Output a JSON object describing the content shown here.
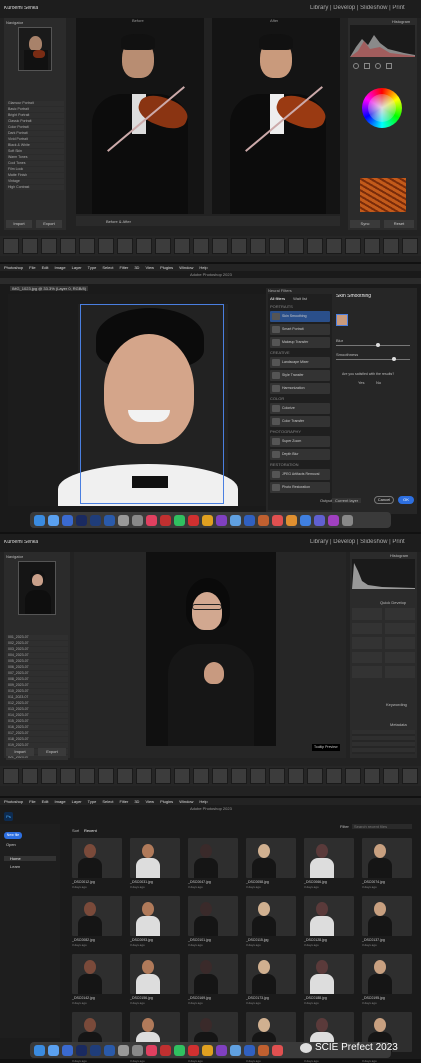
{
  "s1": {
    "app_title": "Kuroemi Senka",
    "modules": "Library | Develop | Slideshow | Print",
    "before_label": "Before",
    "after_label": "After",
    "navigator": "Navigator",
    "histogram": "Histogram",
    "import_btn": "Import",
    "export_btn": "Export",
    "bottom_label": "Before & After",
    "sync": "Sync",
    "reset": "Reset",
    "presets": [
      "Glamour Portrait",
      "Basic Portrait",
      "Bright Portrait",
      "Classic Portrait",
      "Color Portrait",
      "Dark Portrait",
      "Vivid Portrait",
      "Black & White",
      "Soft Skin",
      "Warm Tones",
      "Cool Tones",
      "Film Look",
      "Matte Finish",
      "Vintage",
      "High Contrast"
    ]
  },
  "s2": {
    "menu": [
      "Photoshop",
      "File",
      "Edit",
      "Image",
      "Layer",
      "Type",
      "Select",
      "Filter",
      "3D",
      "View",
      "Plugins",
      "Window",
      "Help"
    ],
    "title": "Adobe Photoshop 2023",
    "tab": "IMG_1023.jpg @ 33.3% (Layer 0, RGB/8)",
    "neural_header": "Neural Filters",
    "neural_tabs": [
      "All filters",
      "Wait list"
    ],
    "portraits_label": "PORTRAITS",
    "filters": [
      "Skin Smoothing",
      "Smart Portrait",
      "Makeup Transfer"
    ],
    "creative_label": "CREATIVE",
    "creative": [
      "Landscape Mixer",
      "Style Transfer",
      "Harmonization"
    ],
    "color_label": "COLOR",
    "color": [
      "Colorize",
      "Color Transfer"
    ],
    "photo_label": "PHOTOGRAPHY",
    "photo": [
      "Super Zoom",
      "Depth Blur"
    ],
    "restore_label": "RESTORATION",
    "restore": [
      "JPEG Artifacts Removal",
      "Photo Restoration"
    ],
    "right_title": "Skin Smoothing",
    "sliders": [
      "Blur",
      "Smoothness"
    ],
    "question": "Are you satisfied with the results?",
    "yes": "Yes",
    "no": "No",
    "output": "Output",
    "output_val": "Current layer",
    "cancel": "Cancel",
    "ok": "OK"
  },
  "s3": {
    "app_title": "Kuroemi Senka",
    "modules": "Library | Develop | Slideshow | Print",
    "navigator": "Navigator",
    "histogram": "Histogram",
    "quick_develop": "Quick Develop",
    "keywording": "Keywording",
    "metadata": "Metadata",
    "import_btn": "Import",
    "export_btn": "Export",
    "tooltip": "Tooltip Preview",
    "folders": [
      "001_2023-07",
      "002_2023-07",
      "003_2023-07",
      "004_2023-07",
      "005_2023-07",
      "006_2023-07",
      "007_2023-07",
      "008_2023-07",
      "009_2023-07",
      "010_2023-07",
      "011_2023-07",
      "012_2023-07",
      "013_2023-07",
      "014_2023-07",
      "015_2023-07",
      "016_2023-07",
      "017_2023-07",
      "018_2023-07",
      "019_2023-07",
      "020_2023-07",
      "021_2023-07"
    ]
  },
  "s4": {
    "menu": [
      "Photoshop",
      "File",
      "Edit",
      "Image",
      "Layer",
      "Type",
      "Select",
      "Filter",
      "3D",
      "View",
      "Plugins",
      "Window",
      "Help"
    ],
    "title": "Adobe Photoshop 2023",
    "new_btn": "New file",
    "open_btn": "Open",
    "nav": [
      "Home",
      "Learn"
    ],
    "sort_label": "Sort",
    "sort_val": "Recent",
    "filter_label": "Filter",
    "search_ph": "Search recent files",
    "files": [
      "_DSC0012.jpg",
      "_DSC0031.jpg",
      "_DSC0047.jpg",
      "_DSC0058.jpg",
      "_DSC0066.jpg",
      "_DSC0074.jpg",
      "_DSC0082.jpg",
      "_DSC0093.jpg",
      "_DSC0101.jpg",
      "_DSC0115.jpg",
      "_DSC0128.jpg",
      "_DSC0137.jpg",
      "_DSC0142.jpg",
      "_DSC0156.jpg",
      "_DSC0169.jpg",
      "_DSC0173.jpg",
      "_DSC0188.jpg",
      "_DSC0195.jpg",
      "_DSC0201.jpg",
      "_DSC0214.jpg",
      "_DSC0229.jpg",
      "_DSC0233.jpg",
      "_DSC0247.jpg",
      "_DSC0258.jpg"
    ],
    "file_sub": "3 days ago"
  },
  "watermark": "SCIE Prefect 2023"
}
